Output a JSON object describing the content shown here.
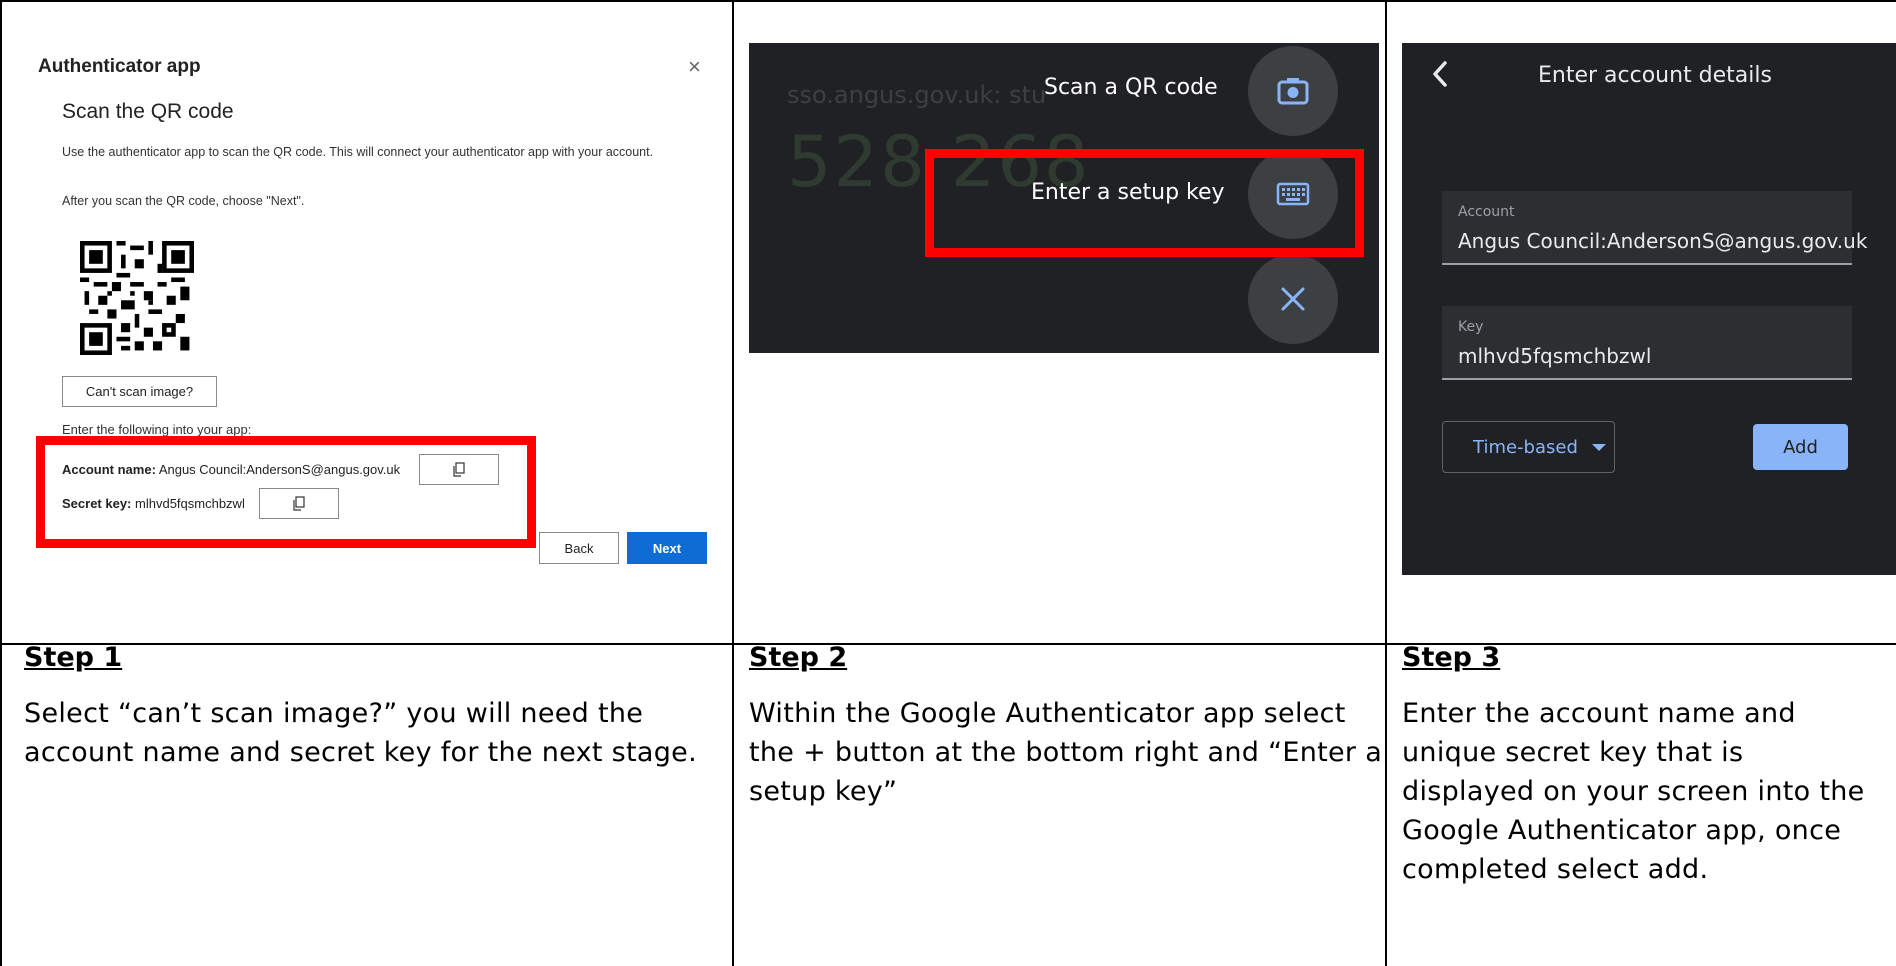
{
  "panel1": {
    "title": "Authenticator app",
    "close_glyph": "×",
    "subtitle": "Scan the QR code",
    "description": "Use the authenticator app to scan the QR code. This will connect your authenticator app with your account.",
    "after_scan": "After you scan the QR code, choose \"Next\".",
    "cant_scan_label": "Can't scan image?",
    "enter_following": "Enter the following into your app:",
    "account_name_label": "Account name:",
    "account_name_value": "Angus Council:AndersonS@angus.gov.uk",
    "secret_key_label": "Secret key:",
    "secret_key_value": "mlhvd5fqsmchbzwl",
    "back_label": "Back",
    "next_label": "Next"
  },
  "panel2": {
    "ghost_url": "sso.angus.gov.uk: stu",
    "ghost_code": "528 268",
    "scan_label": "Scan a QR code",
    "setup_label": "Enter a setup key"
  },
  "panel3": {
    "header": "Enter account details",
    "account_label": "Account",
    "account_value": "Angus Council:AndersonS@angus.gov.uk",
    "key_label": "Key",
    "key_value": "mlhvd5fqsmchbzwl",
    "dropdown_value": "Time-based",
    "add_label": "Add"
  },
  "steps": [
    {
      "title": "Step 1",
      "text": "Select “can’t scan image?” you will need the account name and secret key for the next stage."
    },
    {
      "title": "Step 2",
      "text": "Within the Google Authenticator app select the + button at the bottom right and “Enter a setup key”"
    },
    {
      "title": "Step 3",
      "text": "Enter the account name and unique secret key that is displayed on your screen into the Google Authenticator app, once completed select add."
    }
  ],
  "colors": {
    "highlight": "#ff0000",
    "ms_blue": "#0f6cd5",
    "google_dark": "#202124",
    "google_blue": "#8ab4f8"
  }
}
